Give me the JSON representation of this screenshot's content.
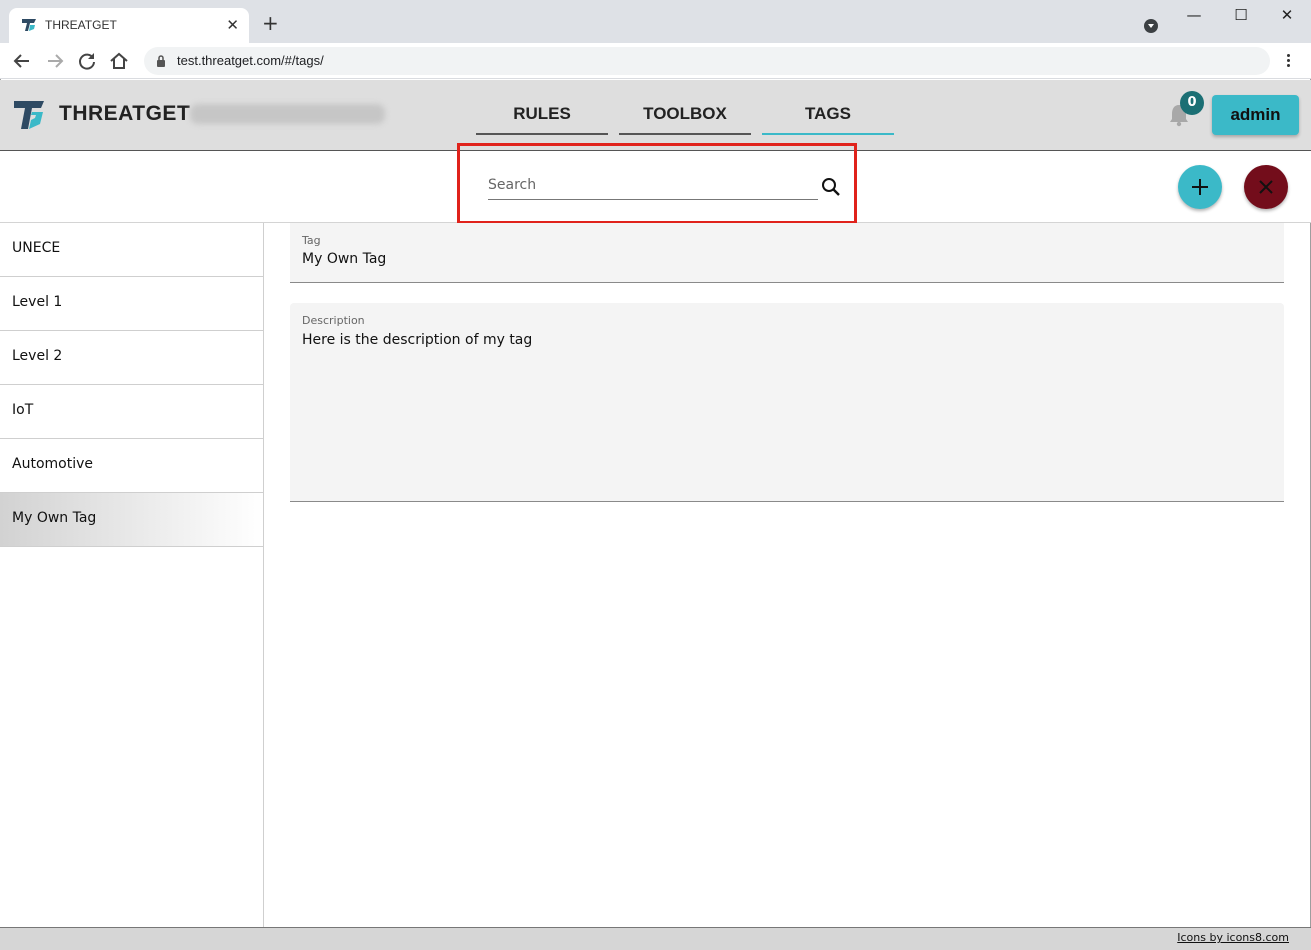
{
  "browser": {
    "tab_title": "THREATGET",
    "tab_close": "✕",
    "new_tab": "+",
    "url": "test.threatget.com/#/tags/",
    "window_controls": {
      "minimize": "—",
      "maximize": "☐",
      "close": "✕"
    }
  },
  "header": {
    "brand": "THREATGET",
    "nav": [
      {
        "label": "RULES",
        "active": false
      },
      {
        "label": "TOOLBOX",
        "active": false
      },
      {
        "label": "TAGS",
        "active": true
      }
    ],
    "notifications_count": "0",
    "user_button": "admin",
    "accent_color": "#3bb9c8"
  },
  "search": {
    "placeholder": "Search",
    "value": ""
  },
  "actions": {
    "add_icon": "plus-icon",
    "close_icon": "close-icon",
    "close_color": "#730d1b"
  },
  "tags": [
    {
      "label": "UNECE",
      "selected": false
    },
    {
      "label": "Level 1",
      "selected": false
    },
    {
      "label": "Level 2",
      "selected": false
    },
    {
      "label": "IoT",
      "selected": false
    },
    {
      "label": "Automotive",
      "selected": false
    },
    {
      "label": "My Own Tag",
      "selected": true
    }
  ],
  "detail": {
    "tag_label": "Tag",
    "tag_value": "My Own Tag",
    "description_label": "Description",
    "description_value": "Here is the description of my tag"
  },
  "footer": {
    "credit": "Icons by icons8.com"
  }
}
